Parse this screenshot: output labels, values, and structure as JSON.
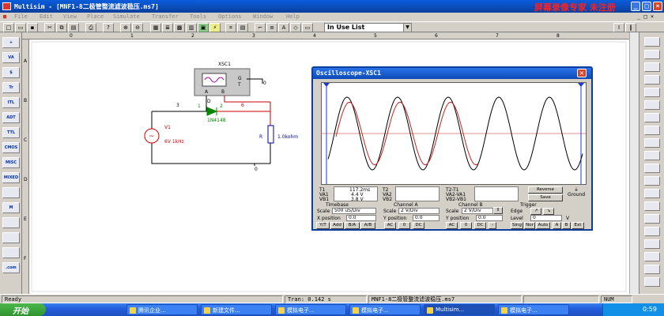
{
  "title": "Multisim - [MNF1-8二极管整流滤波稳压.ms7]",
  "watermark": "屏幕录像专家 未注册",
  "menu": [
    "File",
    "Edit",
    "View",
    "Place",
    "Simulate",
    "Transfer",
    "Tools",
    "Options",
    "Window",
    "Help"
  ],
  "toolbar": {
    "combo": "In Use List"
  },
  "grid": {
    "cols": [
      "0",
      "1",
      "2",
      "3",
      "4",
      "5",
      "6",
      "7",
      "8"
    ],
    "rows": [
      "A",
      "B",
      "C",
      "D",
      "E",
      "F"
    ]
  },
  "left_bin": [
    "+",
    "VA",
    "$",
    "Tr",
    "ITL",
    "ADT",
    "TTL",
    "CMOS",
    "MISC",
    "MIXED",
    "",
    "M",
    "",
    "",
    "",
    ".com"
  ],
  "circuit": {
    "instrument": "XSC1",
    "g": "G",
    "t": "T",
    "a": "A",
    "b": "B",
    "diode_ref": "D",
    "diode_model": "1N4148",
    "source_ref": "V1",
    "source_val": "6V 1kHz",
    "tilde": "~",
    "res_ref": "R",
    "res_val": "1.0kohm",
    "n1": "1",
    "n2": "2",
    "n3": "3",
    "n6": "6",
    "gnd1": "0",
    "gnd2": "0"
  },
  "scope": {
    "title": "Oscilloscope-XSC1",
    "t1_label": "T1",
    "t1": "117.2ms",
    "va1_label": "VA1",
    "va1": "4.4 V",
    "vb1_label": "VB1",
    "vb1": "3.8 V",
    "t2_label": "T2",
    "va2_label": "VA2",
    "vb2_label": "VB2",
    "dt_label": "T2-T1",
    "dva_label": "VA2-VA1",
    "dvb_label": "VB2-VB1",
    "reverse": "Reverse",
    "save": "Save",
    "ground": "Ground",
    "timebase": {
      "title": "Timebase",
      "scale_label": "Scale",
      "scale": "500 uS/Div",
      "xpos_label": "X position",
      "xpos": "0.0",
      "modes": [
        "Y/T",
        "Add",
        "B/A",
        "A/B"
      ]
    },
    "chA": {
      "title": "Channel A",
      "scale_label": "Scale",
      "scale": "2 V/Div",
      "ypos_label": "Y position",
      "ypos": "0.0",
      "coupling": [
        "AC",
        "0",
        "DC"
      ]
    },
    "chB": {
      "title": "Channel B",
      "scale_label": "Scale",
      "scale": "2 V/Div",
      "ypos_label": "Y position",
      "ypos": "0.0",
      "coupling": [
        "AC",
        "0",
        "DC",
        "-"
      ]
    },
    "trigger": {
      "title": "Trigger",
      "edge_label": "Edge",
      "level_label": "Level",
      "level": "0",
      "v": "V",
      "modes": [
        "Sing",
        "Nor",
        "Auto",
        "A",
        "B",
        "Ext"
      ]
    }
  },
  "status": {
    "ready": "Ready",
    "tran": "Tran: 0.142 s",
    "file": "MNF1-8二极管整流滤波稳压.ms7",
    "num": "NUM"
  },
  "taskbar": {
    "start": "开始",
    "tasks": [
      "腾讯企业...",
      "新建文件...",
      "模拟电子...",
      "模拟电子...",
      "Multisim...",
      "模拟电子..."
    ],
    "clock": "0:59"
  },
  "colors": {
    "input_trace": "#000000",
    "output_trace": "#cc2020",
    "cursor": "#1a3ad8"
  }
}
